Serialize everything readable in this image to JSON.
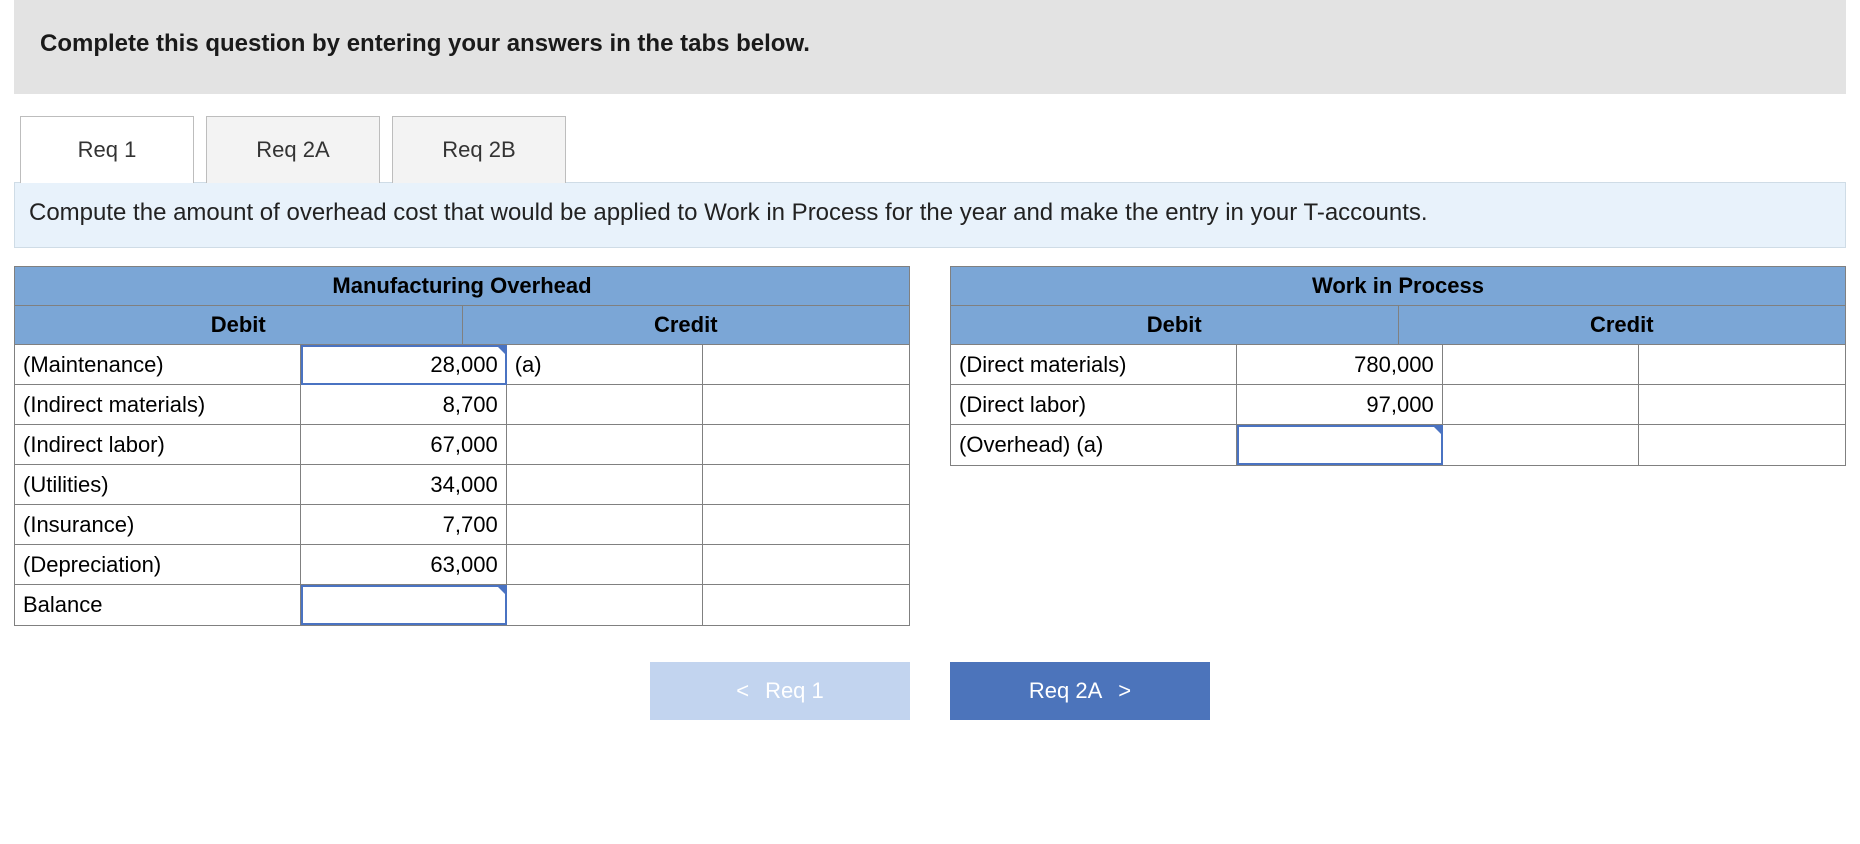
{
  "instruction": "Complete this question by entering your answers in the tabs below.",
  "tabs": {
    "items": [
      {
        "label": "Req 1",
        "active": true
      },
      {
        "label": "Req 2A",
        "active": false
      },
      {
        "label": "Req 2B",
        "active": false
      }
    ]
  },
  "prompt": "Compute the amount of overhead cost that would be applied to Work in Process for the year and make the entry in your T-accounts.",
  "columns": {
    "debit": "Debit",
    "credit": "Credit"
  },
  "overhead": {
    "title": "Manufacturing Overhead",
    "rows": [
      {
        "name": "(Maintenance)",
        "debit": "28,000",
        "credit_name": "(a)",
        "credit": ""
      },
      {
        "name": "(Indirect materials)",
        "debit": "8,700",
        "credit_name": "",
        "credit": ""
      },
      {
        "name": "(Indirect labor)",
        "debit": "67,000",
        "credit_name": "",
        "credit": ""
      },
      {
        "name": "(Utilities)",
        "debit": "34,000",
        "credit_name": "",
        "credit": ""
      },
      {
        "name": "(Insurance)",
        "debit": "7,700",
        "credit_name": "",
        "credit": ""
      },
      {
        "name": "(Depreciation)",
        "debit": "63,000",
        "credit_name": "",
        "credit": ""
      },
      {
        "name": "Balance",
        "debit": "",
        "credit_name": "",
        "credit": ""
      }
    ]
  },
  "wip": {
    "title": "Work in Process",
    "rows": [
      {
        "name": "(Direct materials)",
        "debit": "780,000",
        "credit_name": "",
        "credit": ""
      },
      {
        "name": "(Direct labor)",
        "debit": "97,000",
        "credit_name": "",
        "credit": ""
      },
      {
        "name": "(Overhead) (a)",
        "debit": "",
        "credit_name": "",
        "credit": ""
      }
    ]
  },
  "nav": {
    "prev": "Req 1",
    "next": "Req 2A"
  },
  "icons": {
    "chev_left": "<",
    "chev_right": ">"
  }
}
